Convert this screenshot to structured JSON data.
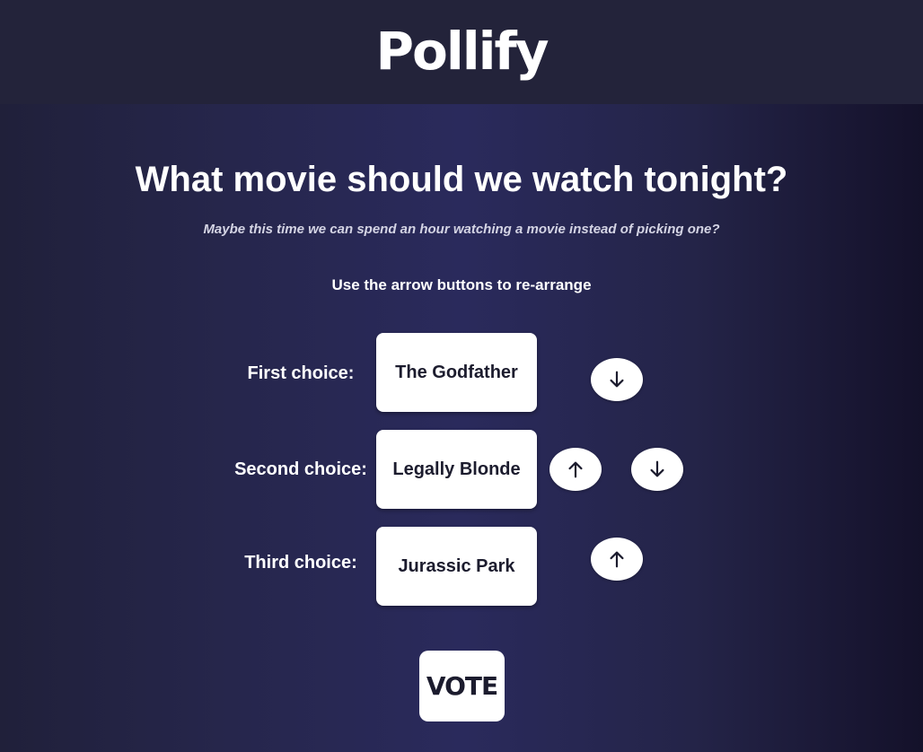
{
  "app": {
    "brand": "Pollify"
  },
  "poll": {
    "title": "What movie should we watch tonight?",
    "subtitle": "Maybe this time we can spend an hour watching a movie instead of picking one?",
    "instructions": "Use the arrow buttons to re-arrange",
    "choices": [
      {
        "label": "First choice:",
        "movie": "The Godfather",
        "buttons": [
          "arrow-down-icon"
        ]
      },
      {
        "label": "Second choice:",
        "movie": "Legally Blonde",
        "buttons": [
          "arrow-up-icon",
          "arrow-down-icon"
        ]
      },
      {
        "label": "Third choice:",
        "movie": "Jurassic Park",
        "buttons": [
          "arrow-up-icon"
        ]
      }
    ],
    "vote_label": "VOTE"
  },
  "colors": {
    "header_bg": "#23233a",
    "card_bg": "#ffffff",
    "card_text": "#1c1c2e",
    "page_text": "#ffffff"
  }
}
